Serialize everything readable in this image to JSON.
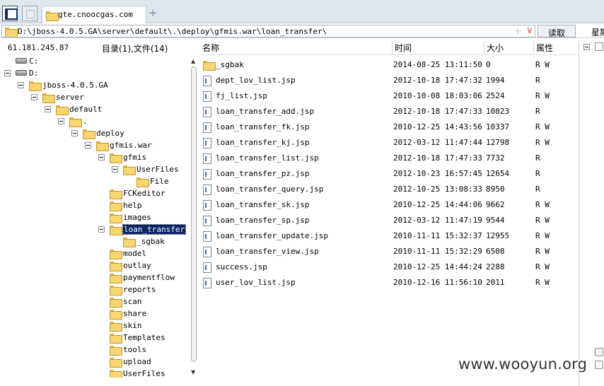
{
  "tabs": {
    "site_tab_label": "gte.cnoocgas.com",
    "new_tab_label": "+"
  },
  "address_bar": {
    "path": "D:\\jboss-4.0.5.GA\\server\\default\\.\\deploy\\gfmis.war\\loan_transfer\\",
    "add_icon": "+",
    "dropdown_icon": "∨",
    "read_button": "读取",
    "star_button": "星期"
  },
  "info": {
    "host": "61.181.245.87",
    "dir_count": "目录(1),文件(14)"
  },
  "tree": [
    {
      "label": "C:",
      "type": "drive",
      "depth": 0,
      "expanded": false
    },
    {
      "label": "D:",
      "type": "drive",
      "depth": 0,
      "expanded": true
    },
    {
      "label": "jboss-4.0.5.GA",
      "type": "folder",
      "depth": 1,
      "expanded": true
    },
    {
      "label": "server",
      "type": "folder",
      "depth": 2,
      "expanded": true
    },
    {
      "label": "default",
      "type": "folder",
      "depth": 3,
      "expanded": true
    },
    {
      "label": ".",
      "type": "folder",
      "depth": 4,
      "expanded": true
    },
    {
      "label": "deploy",
      "type": "folder",
      "depth": 5,
      "expanded": true
    },
    {
      "label": "gfmis.war",
      "type": "folder",
      "depth": 6,
      "expanded": true
    },
    {
      "label": "gfmis",
      "type": "folder",
      "depth": 7,
      "expanded": true
    },
    {
      "label": "UserFiles",
      "type": "folder",
      "depth": 8,
      "expanded": true
    },
    {
      "label": "File",
      "type": "folder",
      "depth": 9,
      "expanded": false
    },
    {
      "label": "FCKeditor",
      "type": "folder",
      "depth": 7,
      "expanded": false
    },
    {
      "label": "help",
      "type": "folder",
      "depth": 7,
      "expanded": false
    },
    {
      "label": "images",
      "type": "folder",
      "depth": 7,
      "expanded": false
    },
    {
      "label": "loan_transfer",
      "type": "folder",
      "depth": 7,
      "expanded": true,
      "selected": true
    },
    {
      "label": "_sgbak",
      "type": "folder",
      "depth": 8,
      "expanded": false
    },
    {
      "label": "model",
      "type": "folder",
      "depth": 7,
      "expanded": false
    },
    {
      "label": "outlay",
      "type": "folder",
      "depth": 7,
      "expanded": false
    },
    {
      "label": "paymentflow",
      "type": "folder",
      "depth": 7,
      "expanded": false
    },
    {
      "label": "reports",
      "type": "folder",
      "depth": 7,
      "expanded": false
    },
    {
      "label": "scan",
      "type": "folder",
      "depth": 7,
      "expanded": false
    },
    {
      "label": "share",
      "type": "folder",
      "depth": 7,
      "expanded": false
    },
    {
      "label": "skin",
      "type": "folder",
      "depth": 7,
      "expanded": false
    },
    {
      "label": "Templates",
      "type": "folder",
      "depth": 7,
      "expanded": false
    },
    {
      "label": "tools",
      "type": "folder",
      "depth": 7,
      "expanded": false
    },
    {
      "label": "upload",
      "type": "folder",
      "depth": 7,
      "expanded": false
    },
    {
      "label": "UserFiles",
      "type": "folder",
      "depth": 7,
      "expanded": false
    }
  ],
  "columns": {
    "name": "名称",
    "time": "时间",
    "size": "大小",
    "attr": "属性"
  },
  "files": [
    {
      "name": "_sgbak",
      "type": "folder",
      "time": "2014-08-25 13:11:50",
      "size": "0",
      "attr": "R W"
    },
    {
      "name": "dept_lov_list.jsp",
      "type": "file",
      "time": "2012-10-18 17:47:32",
      "size": "1994",
      "attr": "R"
    },
    {
      "name": "fj_list.jsp",
      "type": "file",
      "time": "2010-10-08 18:03:06",
      "size": "2524",
      "attr": "R W"
    },
    {
      "name": "loan_transfer_add.jsp",
      "type": "file",
      "time": "2012-10-18 17:47:33",
      "size": "10823",
      "attr": "R"
    },
    {
      "name": "loan_transfer_fk.jsp",
      "type": "file",
      "time": "2010-12-25 14:43:56",
      "size": "10337",
      "attr": "R W"
    },
    {
      "name": "loan_transfer_kj.jsp",
      "type": "file",
      "time": "2012-03-12 11:47:44",
      "size": "12798",
      "attr": "R W"
    },
    {
      "name": "loan_transfer_list.jsp",
      "type": "file",
      "time": "2012-10-18 17:47:33",
      "size": "7732",
      "attr": "R"
    },
    {
      "name": "loan_transfer_pz.jsp",
      "type": "file",
      "time": "2012-10-23 16:57:45",
      "size": "12654",
      "attr": "R"
    },
    {
      "name": "loan_transfer_query.jsp",
      "type": "file",
      "time": "2012-10-25 13:08:33",
      "size": "8950",
      "attr": "R"
    },
    {
      "name": "loan_transfer_sk.jsp",
      "type": "file",
      "time": "2010-12-25 14:44:06",
      "size": "9662",
      "attr": "R W"
    },
    {
      "name": "loan_transfer_sp.jsp",
      "type": "file",
      "time": "2012-03-12 11:47:19",
      "size": "9544",
      "attr": "R W"
    },
    {
      "name": "loan_transfer_update.jsp",
      "type": "file",
      "time": "2010-11-11 15:32:37",
      "size": "12955",
      "attr": "R W"
    },
    {
      "name": "loan_transfer_view.jsp",
      "type": "file",
      "time": "2010-11-11 15:32:29",
      "size": "6508",
      "attr": "R W"
    },
    {
      "name": "success.jsp",
      "type": "file",
      "time": "2010-12-25 14:44:24",
      "size": "2288",
      "attr": "R W"
    },
    {
      "name": "user_lov_list.jsp",
      "type": "file",
      "time": "2010-12-16 11:56:10",
      "size": "2011",
      "attr": "R W"
    }
  ],
  "watermark": "www.wooyun.org"
}
